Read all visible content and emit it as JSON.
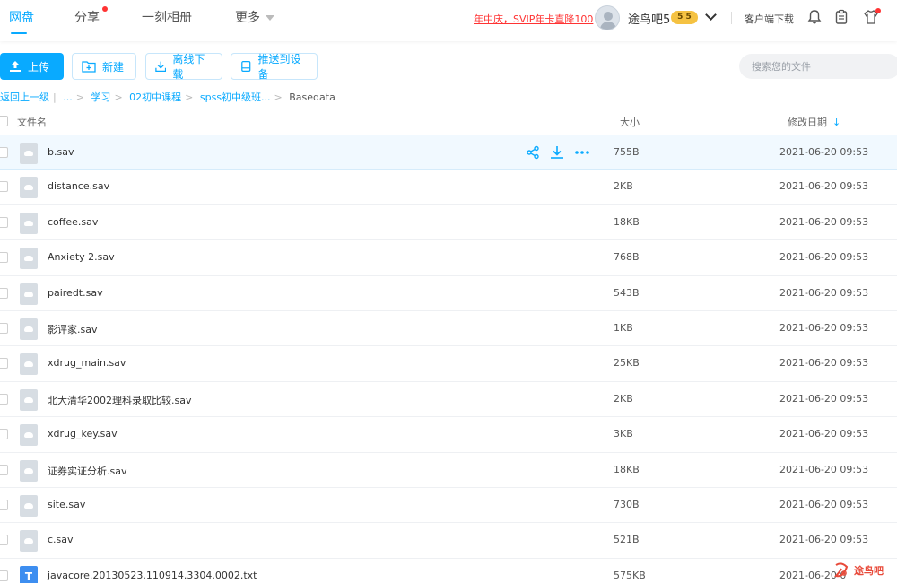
{
  "nav": {
    "tabs": [
      {
        "label": "网盘",
        "active": true
      },
      {
        "label": "分享",
        "badge_dot": true
      },
      {
        "label": "一刻相册"
      },
      {
        "label": "更多"
      }
    ],
    "promo": "年中庆，SVIP年卡直降100",
    "username": "途鸟吧5",
    "vip_badge": "5 5",
    "client_download": "客户端下载",
    "icons": [
      "bell-icon",
      "clipboard-icon",
      "shirt-icon"
    ]
  },
  "toolbar": {
    "upload": "上传",
    "new": "新建",
    "offline_download": "离线下载",
    "push_to_device": "推送到设备",
    "search_placeholder": "搜索您的文件"
  },
  "breadcrumb": {
    "back": "返回上一级",
    "ellipsis": "...",
    "items": [
      "学习",
      "02初中课程",
      "spss初中级班..."
    ],
    "current": "Basedata"
  },
  "table": {
    "headers": {
      "name": "文件名",
      "size": "大小",
      "date": "修改日期"
    },
    "rows": [
      {
        "name": "b.sav",
        "size": "755B",
        "date": "2021-06-20 09:53",
        "type": "sav"
      },
      {
        "name": "distance.sav",
        "size": "2KB",
        "date": "2021-06-20 09:53",
        "type": "sav"
      },
      {
        "name": "coffee.sav",
        "size": "18KB",
        "date": "2021-06-20 09:53",
        "type": "sav"
      },
      {
        "name": "Anxiety 2.sav",
        "size": "768B",
        "date": "2021-06-20 09:53",
        "type": "sav"
      },
      {
        "name": "pairedt.sav",
        "size": "543B",
        "date": "2021-06-20 09:53",
        "type": "sav"
      },
      {
        "name": "影评家.sav",
        "size": "1KB",
        "date": "2021-06-20 09:53",
        "type": "sav"
      },
      {
        "name": "xdrug_main.sav",
        "size": "25KB",
        "date": "2021-06-20 09:53",
        "type": "sav"
      },
      {
        "name": "北大清华2002理科录取比较.sav",
        "size": "2KB",
        "date": "2021-06-20 09:53",
        "type": "sav"
      },
      {
        "name": "xdrug_key.sav",
        "size": "3KB",
        "date": "2021-06-20 09:53",
        "type": "sav"
      },
      {
        "name": "证券实证分析.sav",
        "size": "18KB",
        "date": "2021-06-20 09:53",
        "type": "sav"
      },
      {
        "name": "site.sav",
        "size": "730B",
        "date": "2021-06-20 09:53",
        "type": "sav"
      },
      {
        "name": "c.sav",
        "size": "521B",
        "date": "2021-06-20 09:53",
        "type": "sav"
      },
      {
        "name": "javacore.20130523.110914.3304.0002.txt",
        "size": "575KB",
        "date": "2021-06-20 0",
        "type": "txt"
      }
    ]
  },
  "watermark": "途鸟吧",
  "colors": {
    "accent": "#09AAFF",
    "promo": "#FF3333",
    "hover_row": "#F1F9FF"
  }
}
